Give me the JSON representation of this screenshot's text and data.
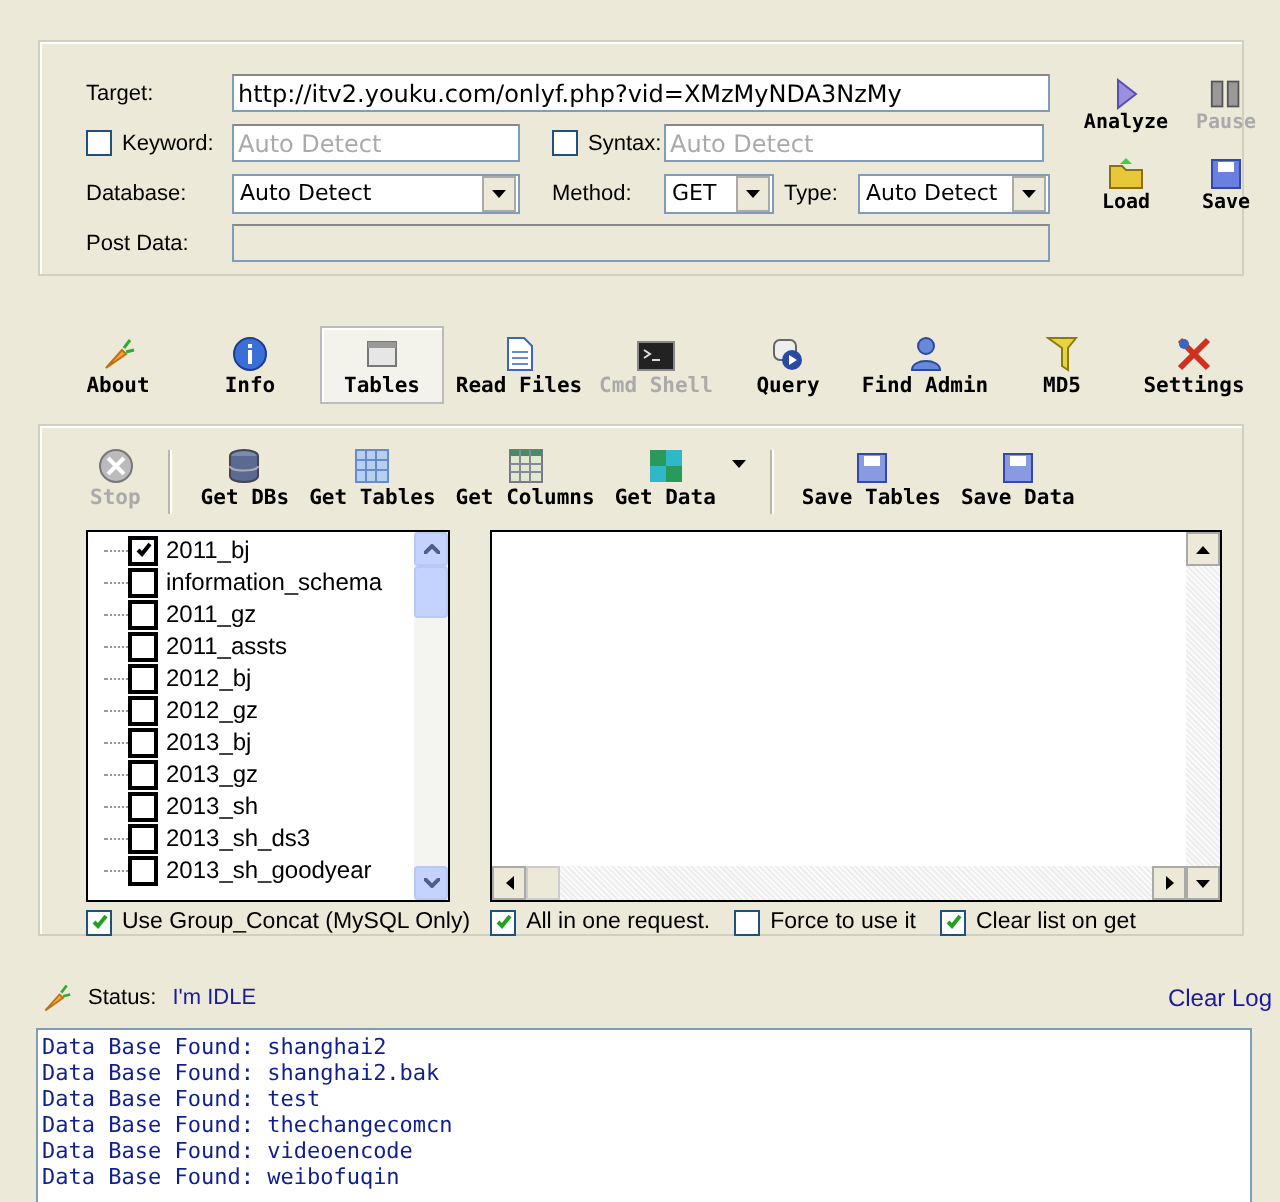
{
  "target": {
    "label": "Target:",
    "value": "http://itv2.youku.com/onlyf.php?vid=XMzMyNDA3NzMy"
  },
  "keyword": {
    "label": "Keyword:",
    "checked": false,
    "placeholder": "Auto Detect"
  },
  "syntax": {
    "label": "Syntax:",
    "checked": false,
    "placeholder": "Auto Detect"
  },
  "database": {
    "label": "Database:",
    "value": "Auto Detect"
  },
  "method": {
    "label": "Method:",
    "value": "GET"
  },
  "type": {
    "label": "Type:",
    "value": "Auto Detect"
  },
  "post_data": {
    "label": "Post Data:",
    "disabled": true
  },
  "actions": [
    {
      "label": "Analyze",
      "disabled": false
    },
    {
      "label": "Pause",
      "disabled": true
    },
    {
      "label": "Load",
      "disabled": false
    },
    {
      "label": "Save",
      "disabled": false
    }
  ],
  "tabs": [
    {
      "label": "About",
      "selected": false,
      "disabled": false
    },
    {
      "label": "Info",
      "selected": false,
      "disabled": false
    },
    {
      "label": "Tables",
      "selected": true,
      "disabled": false
    },
    {
      "label": "Read Files",
      "selected": false,
      "disabled": false
    },
    {
      "label": "Cmd Shell",
      "selected": false,
      "disabled": true
    },
    {
      "label": "Query",
      "selected": false,
      "disabled": false
    },
    {
      "label": "Find Admin",
      "selected": false,
      "disabled": false
    },
    {
      "label": "MD5",
      "selected": false,
      "disabled": false
    },
    {
      "label": "Settings",
      "selected": false,
      "disabled": false
    }
  ],
  "toolbar": [
    {
      "kind": "button",
      "label": "Stop",
      "disabled": true
    },
    {
      "kind": "separator"
    },
    {
      "kind": "button",
      "label": "Get DBs",
      "disabled": false
    },
    {
      "kind": "button",
      "label": "Get Tables",
      "disabled": false
    },
    {
      "kind": "button",
      "label": "Get Columns",
      "disabled": false
    },
    {
      "kind": "button",
      "label": "Get Data",
      "disabled": false
    },
    {
      "kind": "dropdown"
    },
    {
      "kind": "separator"
    },
    {
      "kind": "button",
      "label": "Save Tables",
      "disabled": false
    },
    {
      "kind": "button",
      "label": "Save Data",
      "disabled": false
    }
  ],
  "databases": [
    {
      "label": "2011_bj",
      "checked": true
    },
    {
      "label": "information_schema",
      "checked": false
    },
    {
      "label": "2011_gz",
      "checked": false
    },
    {
      "label": "2011_assts",
      "checked": false
    },
    {
      "label": "2012_bj",
      "checked": false
    },
    {
      "label": "2012_gz",
      "checked": false
    },
    {
      "label": "2013_bj",
      "checked": false
    },
    {
      "label": "2013_gz",
      "checked": false
    },
    {
      "label": "2013_sh",
      "checked": false
    },
    {
      "label": "2013_sh_ds3",
      "checked": false
    },
    {
      "label": "2013_sh_goodyear",
      "checked": false
    }
  ],
  "tree_options": [
    {
      "label": "Use Group_Concat (MySQL Only)",
      "checked": true
    }
  ],
  "result_options": [
    {
      "label": "All in one request.",
      "checked": true
    },
    {
      "label": "Force to use it",
      "checked": false
    },
    {
      "label": "Clear list on get",
      "checked": true
    }
  ],
  "status": {
    "label": "Status:",
    "value": "I'm IDLE"
  },
  "clear_log": "Clear Log",
  "log": [
    "Data Base Found: shanghai2",
    "Data Base Found: shanghai2.bak",
    "Data Base Found: test",
    "Data Base Found: thechangecomcn",
    "Data Base Found: videoencode",
    "Data Base Found: weibofuqin"
  ]
}
